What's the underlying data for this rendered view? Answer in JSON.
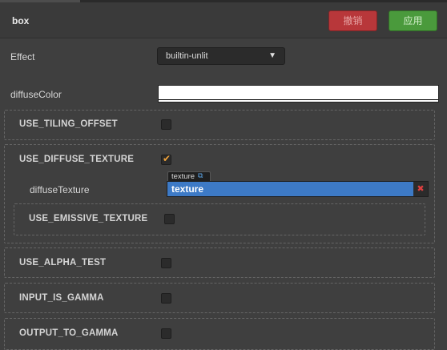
{
  "header": {
    "title": "box",
    "cancel_label": "撤销",
    "apply_label": "应用"
  },
  "effect": {
    "label": "Effect",
    "selected": "builtin-unlit"
  },
  "diffuse_color": {
    "label": "diffuseColor",
    "value": "#ffffff"
  },
  "defines": [
    {
      "label": "USE_TILING_OFFSET",
      "checked": false
    },
    {
      "label": "USE_DIFFUSE_TEXTURE",
      "checked": true
    },
    {
      "label": "USE_EMISSIVE_TEXTURE",
      "checked": false
    },
    {
      "label": "USE_ALPHA_TEST",
      "checked": false
    },
    {
      "label": "INPUT_IS_GAMMA",
      "checked": false
    },
    {
      "label": "OUTPUT_TO_GAMMA",
      "checked": false
    }
  ],
  "diffuse_texture": {
    "label": "diffuseTexture",
    "asset_type": "texture",
    "asset_name": "texture"
  },
  "colors": {
    "background": "#3f3f3f",
    "cancel": "#b8373a",
    "apply": "#4a9a3c",
    "asset_field": "#3d7ac6",
    "checkmark": "#f1a33a"
  }
}
